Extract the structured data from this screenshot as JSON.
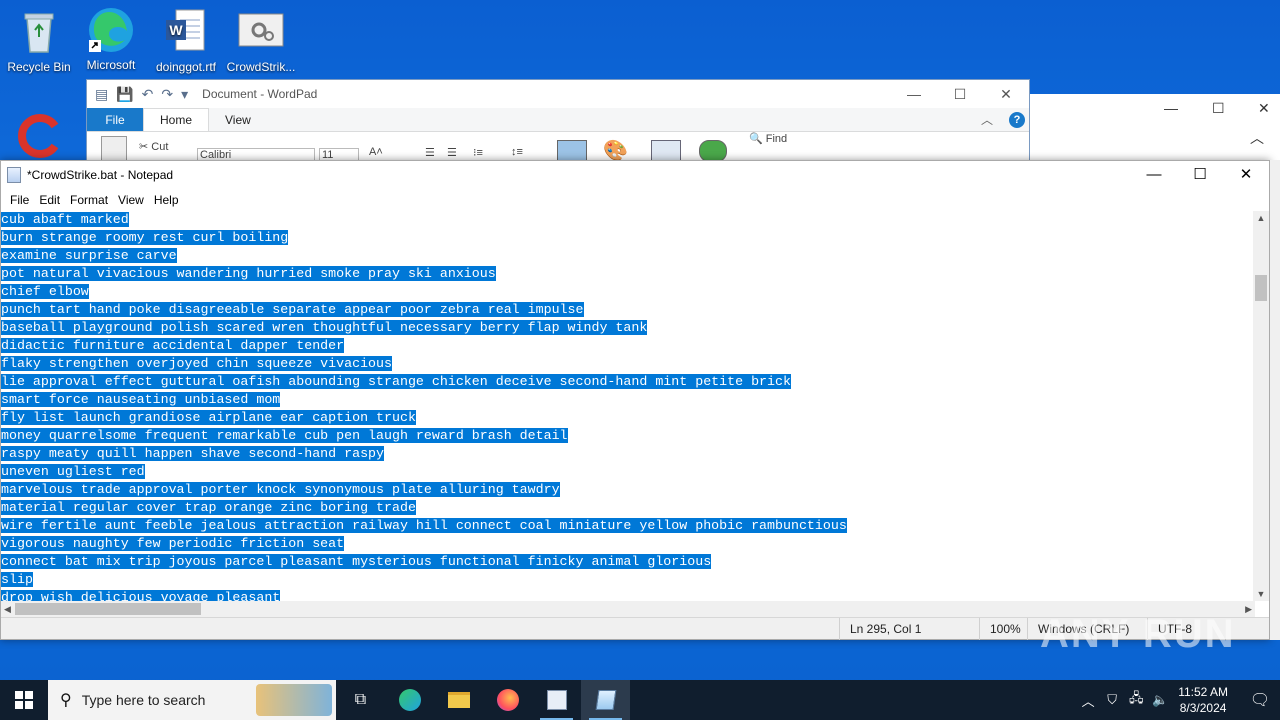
{
  "desktop": {
    "icons": [
      {
        "label": "Recycle Bin",
        "icon": "recycle-bin-icon"
      },
      {
        "label": "Microsoft",
        "icon": "edge-icon"
      },
      {
        "label": "doinggot.rtf",
        "icon": "word-doc-icon"
      },
      {
        "label": "CrowdStrik...",
        "icon": "settings-file-icon"
      }
    ]
  },
  "wordpad": {
    "title": "Document - WordPad",
    "tabs": {
      "file": "File",
      "home": "Home",
      "view": "View"
    },
    "ribbon": {
      "cut": "Cut",
      "font": "Calibri",
      "size": "11",
      "find": "Find"
    }
  },
  "notepad": {
    "title": "*CrowdStrike.bat - Notepad",
    "menu": [
      "File",
      "Edit",
      "Format",
      "View",
      "Help"
    ],
    "lines": [
      "cub abaft marked",
      "burn strange roomy rest curl boiling",
      "examine surprise carve",
      "pot natural vivacious wandering hurried smoke pray ski anxious",
      "chief elbow",
      "punch tart hand poke disagreeable separate appear poor zebra real impulse",
      "baseball playground polish scared wren thoughtful necessary berry flap windy tank",
      "didactic furniture accidental dapper tender",
      "flaky strengthen overjoyed chin squeeze vivacious",
      "lie approval effect guttural oafish abounding strange chicken deceive second-hand mint petite brick",
      "smart force nauseating unbiased mom",
      "fly list launch grandiose airplane ear caption truck",
      "money quarrelsome frequent remarkable cub pen laugh reward brash detail",
      "raspy meaty quill happen shave second-hand raspy",
      "uneven ugliest red",
      "marvelous trade approval porter knock synonymous plate alluring tawdry",
      "material regular cover trap orange zinc boring trade",
      "wire fertile aunt feeble jealous attraction railway hill connect coal miniature yellow phobic rambunctious",
      "vigorous naughty few periodic friction seat",
      "connect bat mix trip joyous parcel pleasant mysterious functional finicky animal glorious",
      "slip",
      "drop wish delicious voyage pleasant"
    ],
    "status": {
      "position": "Ln 295, Col 1",
      "zoom": "100%",
      "line_ending": "Windows (CRLF)",
      "encoding": "UTF-8"
    }
  },
  "watermark": "ANY RUN",
  "taskbar": {
    "search_placeholder": "Type here to search",
    "time": "11:52 AM",
    "date": "8/3/2024"
  },
  "colors": {
    "selection": "#0078d7",
    "taskbar": "#101e2e",
    "desktop": "#0b5fd1"
  }
}
